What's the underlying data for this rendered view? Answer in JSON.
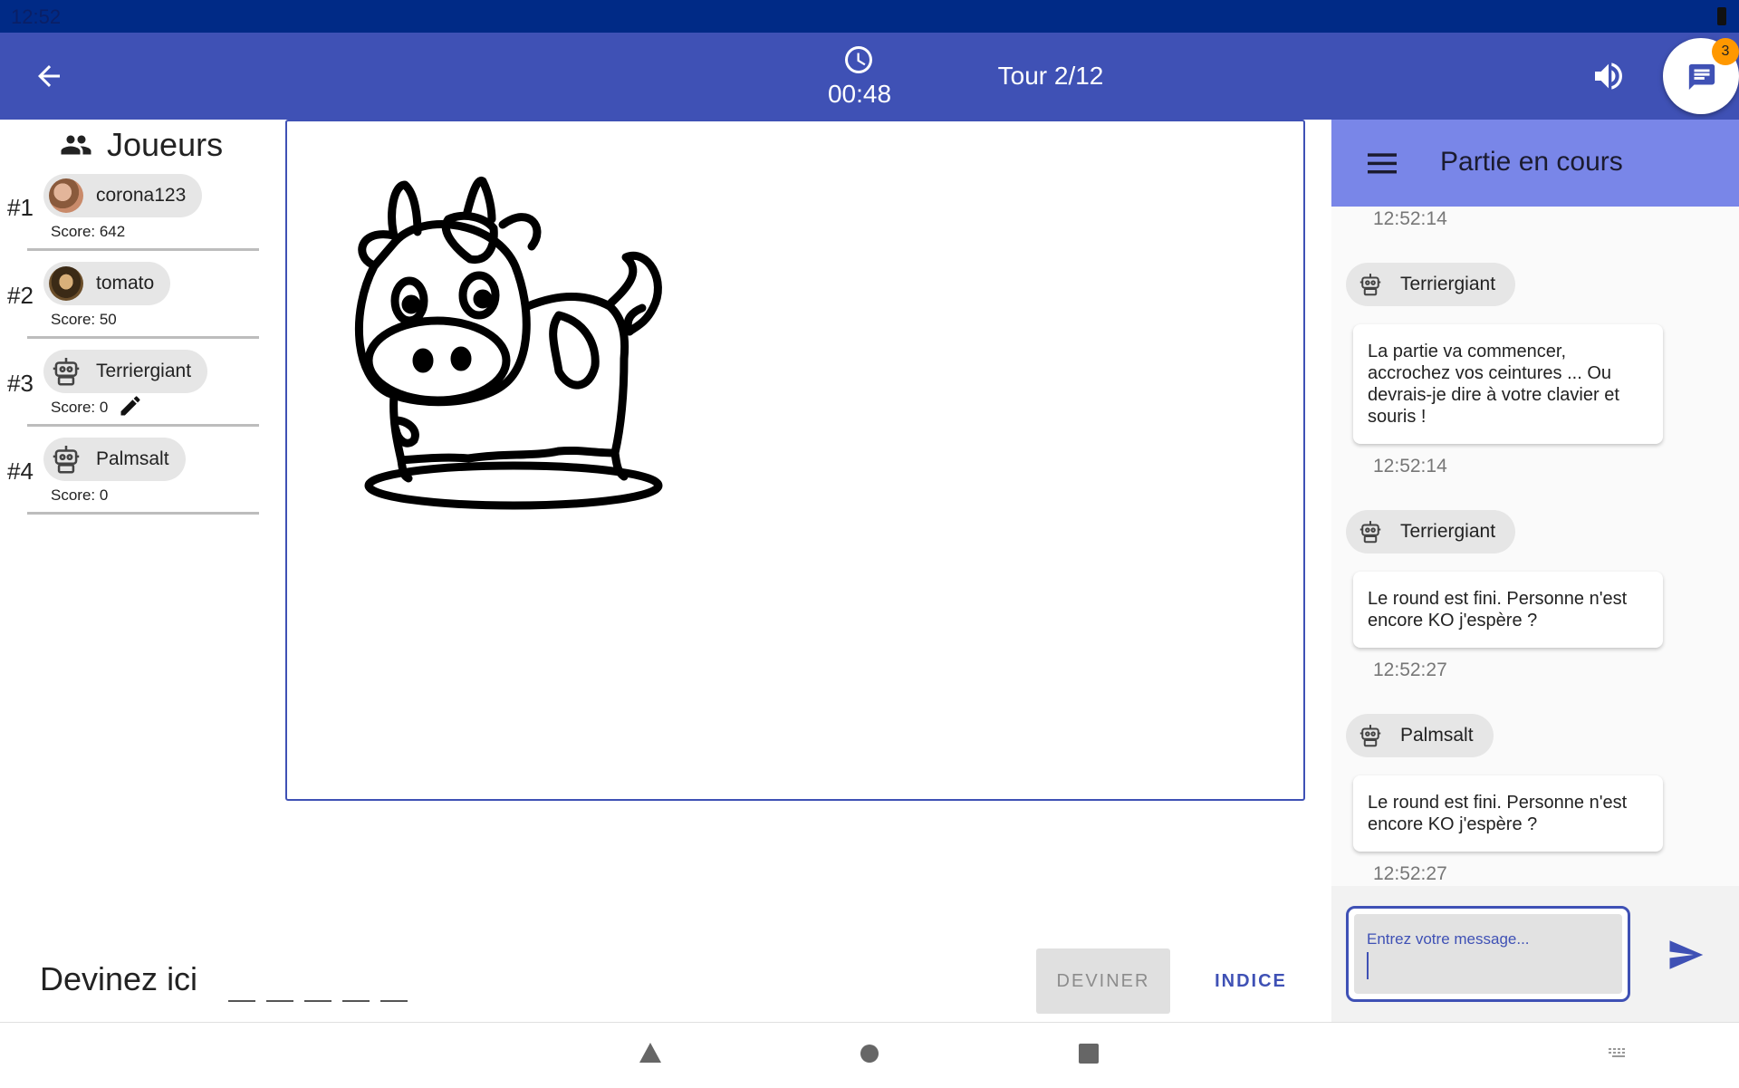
{
  "status_bar": {
    "time": "12:52"
  },
  "app_bar": {
    "timer": "00:48",
    "round": "Tour 2/12",
    "chat_badge": "3"
  },
  "players": {
    "title": "Joueurs",
    "list": [
      {
        "rank": "#1",
        "name": "corona123",
        "score": "Score: 642",
        "avatar": "photo-avatar",
        "drawing": false
      },
      {
        "rank": "#2",
        "name": "tomato",
        "score": "Score: 50",
        "avatar": "photo-avatar",
        "drawing": false
      },
      {
        "rank": "#3",
        "name": "Terriergiant",
        "score": "Score: 0",
        "avatar": "robot-icon",
        "drawing": true
      },
      {
        "rank": "#4",
        "name": "Palmsalt",
        "score": "Score: 0",
        "avatar": "robot-icon",
        "drawing": false
      }
    ]
  },
  "guess": {
    "label": "Devinez ici",
    "blank_count": 5,
    "guess_button": "DEVINER",
    "hint_button": "INDICE"
  },
  "chat": {
    "title": "Partie en cours",
    "top_timestamp": "12:52:14",
    "messages": [
      {
        "author": "Terriergiant",
        "text": "La partie va commencer, accrochez vos ceintures ... Ou devrais-je dire à votre clavier et souris !",
        "time": "12:52:14"
      },
      {
        "author": "Terriergiant",
        "text": "Le round est fini. Personne n'est encore KO j'espère ?",
        "time": "12:52:27"
      },
      {
        "author": "Palmsalt",
        "text": "Le round est fini. Personne n'est encore KO j'espère ?",
        "time": "12:52:27"
      }
    ],
    "input_placeholder": "Entrez votre message..."
  },
  "colors": {
    "status_bar": "#002a86",
    "app_bar": "#3f51b5",
    "chat_header": "#7986e8",
    "badge": "#ff9800",
    "accent": "#3f51b5"
  }
}
